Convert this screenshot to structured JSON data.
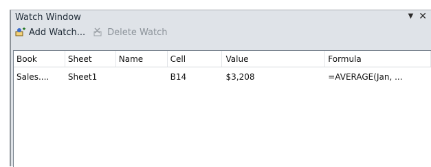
{
  "window": {
    "title": "Watch Window",
    "dropdown_glyph": "▼",
    "close_glyph": "✕"
  },
  "toolbar": {
    "add_label": "Add Watch...",
    "delete_label": "Delete Watch"
  },
  "table": {
    "columns": [
      "Book",
      "Sheet",
      "Name",
      "Cell",
      "Value",
      "Formula"
    ],
    "rows": [
      {
        "book": "Sales....",
        "sheet": "Sheet1",
        "name": "",
        "cell": "B14",
        "value": "$3,208",
        "formula": "=AVERAGE(Jan, ..."
      }
    ]
  },
  "colors": {
    "panel": "#dfe3e8",
    "list_bg": "#ffffff"
  }
}
